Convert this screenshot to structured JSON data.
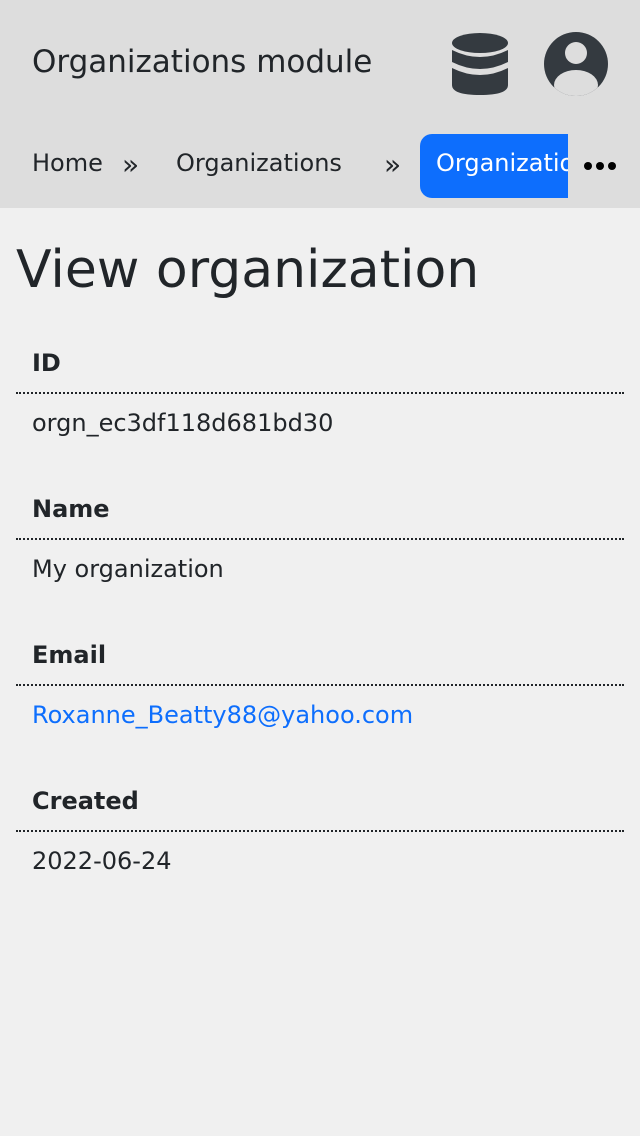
{
  "header": {
    "title": "Organizations module",
    "icons": {
      "database": "database-icon",
      "user": "user-circle-icon"
    }
  },
  "breadcrumb": {
    "items": [
      {
        "label": "Home"
      },
      {
        "label": "Organizations"
      },
      {
        "label": "Organization"
      }
    ],
    "separator": "»",
    "more_icon": "ellipsis-icon"
  },
  "page": {
    "title": "View organization"
  },
  "fields": [
    {
      "label": "ID",
      "value": "orgn_ec3df118d681bd30"
    },
    {
      "label": "Name",
      "value": "My organization"
    },
    {
      "label": "Email",
      "value": "Roxanne_Beatty88@yahoo.com"
    },
    {
      "label": "Created",
      "value": "2022-06-24"
    }
  ],
  "colors": {
    "accent": "#0d6efd",
    "header_bg": "#dddddd",
    "page_bg": "#f0f0f0",
    "text": "#212529"
  }
}
